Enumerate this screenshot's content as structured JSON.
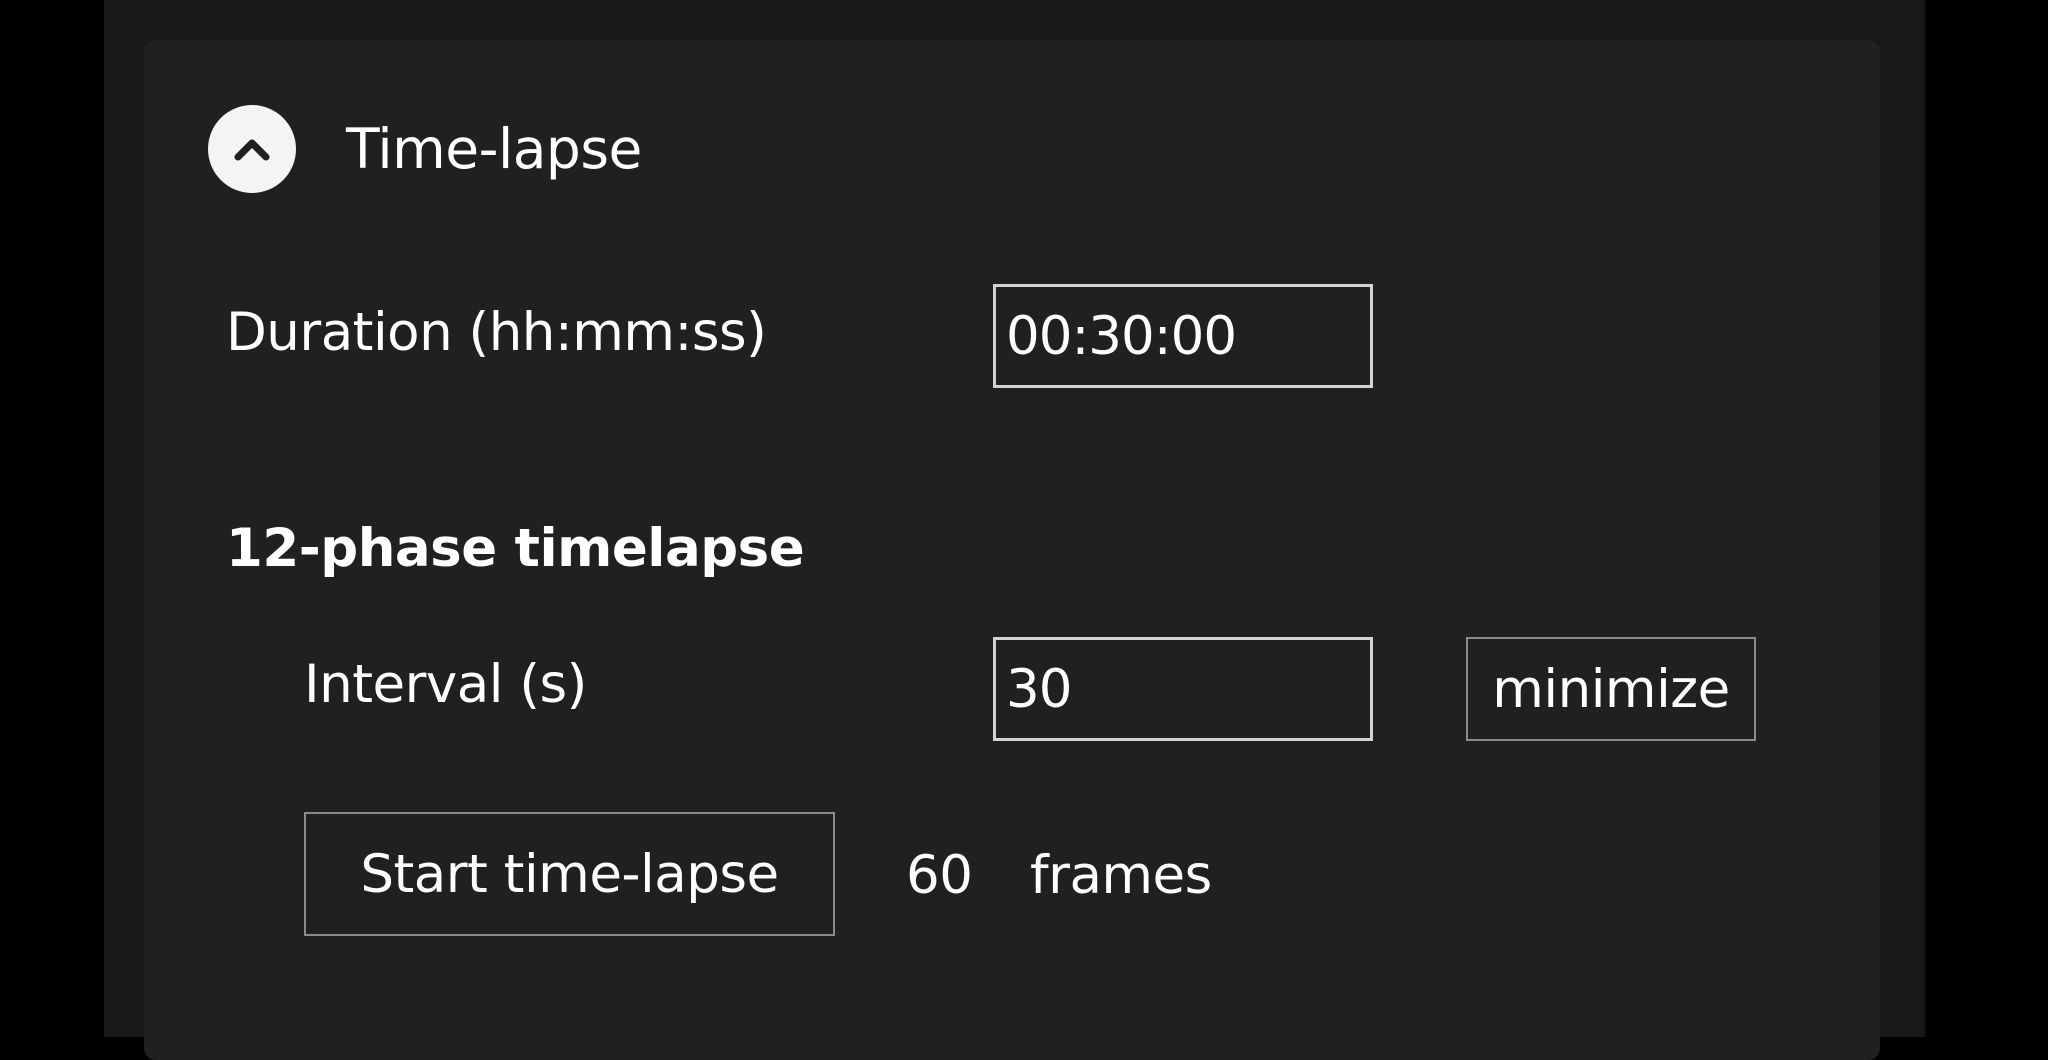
{
  "timelapse": {
    "title": "Time-lapse",
    "collapse_icon": "chevron-up-icon",
    "duration_label": "Duration (hh:mm:ss)",
    "duration_value": "00:30:00",
    "phase_heading": "12-phase timelapse",
    "interval_label": "Interval (s)",
    "interval_value": "30",
    "minimize_label": "minimize",
    "start_label": "Start time-lapse",
    "frame_count": "60",
    "frames_label": "frames"
  },
  "colors": {
    "background": "#000000",
    "panel": "#202020",
    "text": "#ffffff",
    "input_border": "#d3d3d3",
    "button_border": "#8a8a8a"
  }
}
